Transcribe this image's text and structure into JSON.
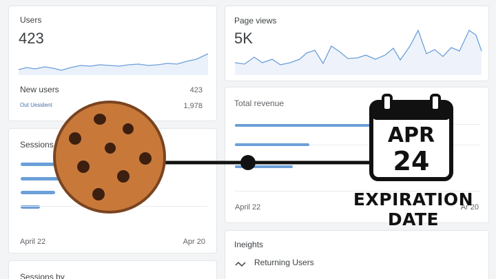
{
  "users_card": {
    "title": "Users",
    "value": "423",
    "new_users_label": "New users",
    "new_users_value": "423",
    "sub_label": "Out Uesident",
    "sub_value": "1,978"
  },
  "pageviews_card": {
    "title": "Page views",
    "value": "5K"
  },
  "sessions_card": {
    "title": "Sessions",
    "date_start": "April 22",
    "date_end": "Apr 20"
  },
  "sessions_by_card": {
    "title": "Sessions by"
  },
  "revenue_card": {
    "title": "Total revenue",
    "date_start": "April 22",
    "date_end": "Ar 20"
  },
  "insights_card": {
    "title": "Ineights",
    "item": "Returning Users"
  },
  "overlay": {
    "calendar_month": "APR",
    "calendar_day": "24",
    "caption_line1": "EXPIRATION",
    "caption_line2": "DATE",
    "cookie_icon": "cookie-icon",
    "calendar_icon": "calendar-icon"
  },
  "colors": {
    "accent": "#6b9fd8",
    "cookie": "#c8793a",
    "cookie_edge": "#7a4420",
    "chip": "#3d1f10",
    "ink": "#111111"
  }
}
